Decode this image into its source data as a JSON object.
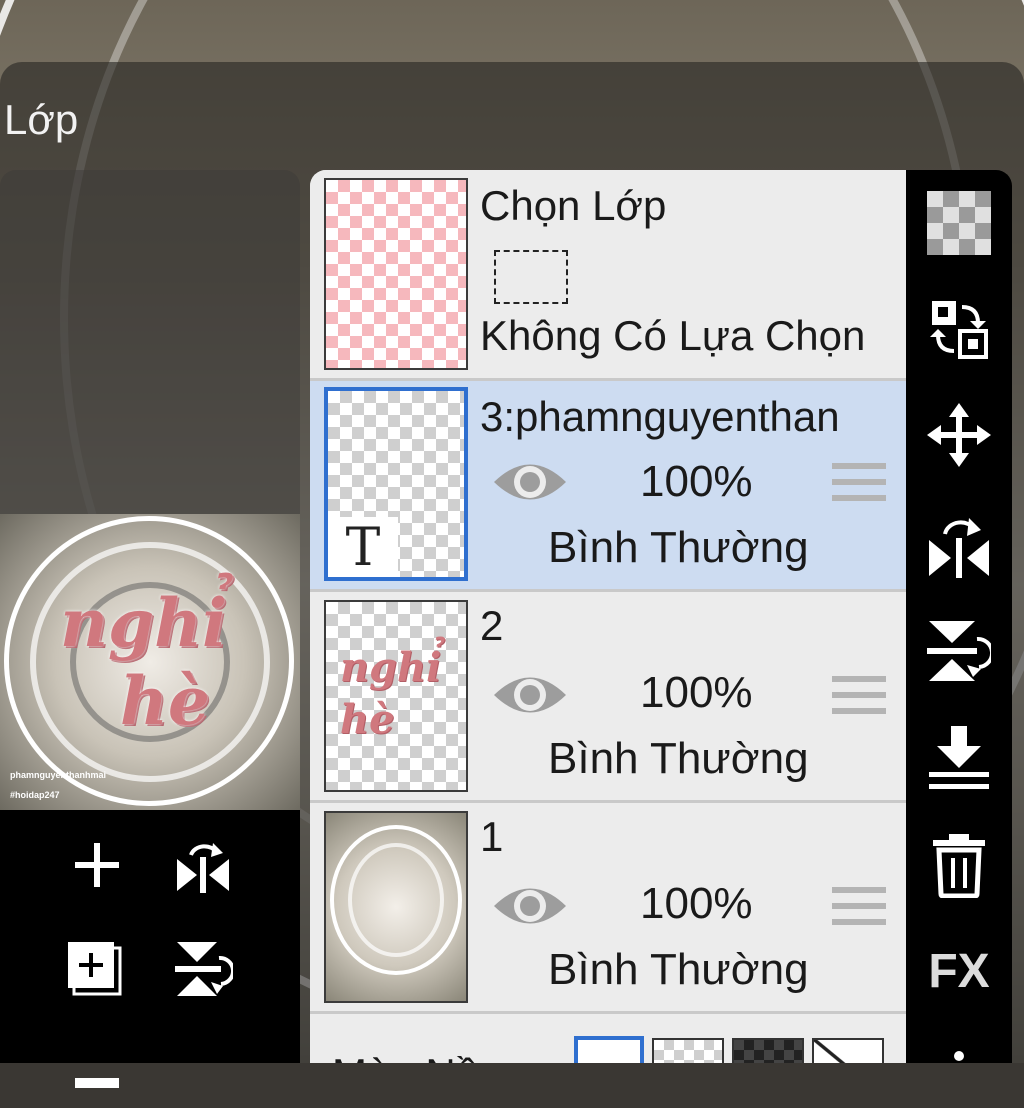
{
  "panel": {
    "title": "Lớp"
  },
  "selection_layer": {
    "name": "Chọn Lớp",
    "status": "Không Có Lựa Chọn"
  },
  "layers": [
    {
      "name": "3:phamnguyenthan",
      "opacity": "100%",
      "blend": "Bình Thường",
      "selected": true,
      "type": "text",
      "type_glyph": "T"
    },
    {
      "name": "2",
      "opacity": "100%",
      "blend": "Bình Thường",
      "selected": false,
      "type": "art",
      "art_text": "nghỉ hè"
    },
    {
      "name": "1",
      "opacity": "100%",
      "blend": "Bình Thường",
      "selected": false,
      "type": "photo"
    }
  ],
  "preview": {
    "art_text_line1": "nghỉ",
    "art_text_line2": "hè",
    "caption1": "phamnguyenthanhmai",
    "caption2": "#hoidap247"
  },
  "background_row": {
    "label": "Màu Nền"
  },
  "right_toolbar": {
    "fx_label": "FX"
  },
  "colors": {
    "selected_row": "#cddcf1",
    "selected_border": "#2f6fcf",
    "art_pink": "#d0787e"
  }
}
